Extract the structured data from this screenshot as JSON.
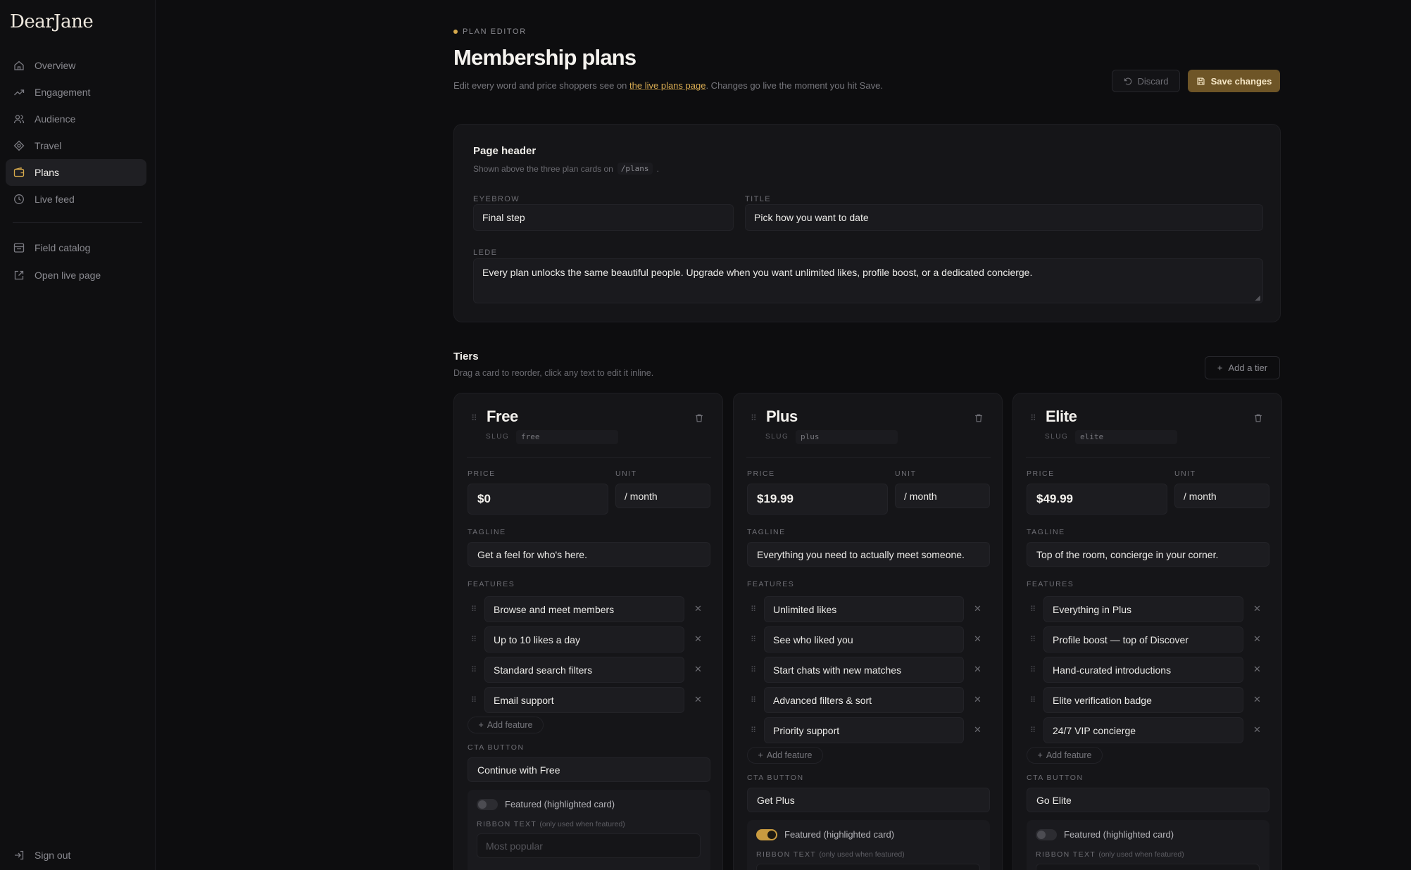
{
  "brand": "DearJane",
  "sidebar": {
    "items": [
      {
        "label": "Overview",
        "icon": "home-icon"
      },
      {
        "label": "Engagement",
        "icon": "trend-up-icon"
      },
      {
        "label": "Audience",
        "icon": "users-icon"
      },
      {
        "label": "Travel",
        "icon": "compass-icon"
      },
      {
        "label": "Plans",
        "icon": "wallet-icon",
        "active": true
      },
      {
        "label": "Live feed",
        "icon": "clock-icon"
      }
    ],
    "secondary": [
      {
        "label": "Field catalog",
        "icon": "catalog-icon"
      },
      {
        "label": "Open live page",
        "icon": "external-link-icon"
      }
    ],
    "signout": "Sign out"
  },
  "header": {
    "eyebrow": "PLAN EDITOR",
    "title": "Membership plans",
    "subtitle_pre": "Edit every word and price shoppers see on ",
    "subtitle_link": "the live plans page",
    "subtitle_post": ". Changes go live the moment you hit Save.",
    "discard_label": "Discard",
    "save_label": "Save changes"
  },
  "page_header_panel": {
    "title": "Page header",
    "subtitle": "Shown above the three plan cards on",
    "path": "/plans",
    "subtitle_end": ".",
    "eyebrow_label": "EYEBROW",
    "eyebrow_value": "Final step",
    "title_label": "TITLE",
    "title_value": "Pick how you want to date",
    "lede_label": "LEDE",
    "lede_value": "Every plan unlocks the same beautiful people. Upgrade when you want unlimited likes, profile boost, or a dedicated concierge."
  },
  "tiers": {
    "title": "Tiers",
    "subtitle": "Drag a card to reorder, click any text to edit it inline.",
    "add_tier_label": "Add a tier",
    "labels": {
      "slug": "SLUG",
      "price": "PRICE",
      "unit": "UNIT",
      "tagline": "TAGLINE",
      "features": "FEATURES",
      "add_feature": "Add feature",
      "cta": "CTA BUTTON",
      "featured": "Featured (highlighted card)",
      "ribbon": "RIBBON TEXT",
      "ribbon_hint": "(only used when featured)",
      "ribbon_placeholder": "Most popular"
    },
    "cards": [
      {
        "name": "Free",
        "slug": "free",
        "price": "$0",
        "unit": "/ month",
        "tagline": "Get a feel for who's here.",
        "features": [
          "Browse and meet members",
          "Up to 10 likes a day",
          "Standard search filters",
          "Email support"
        ],
        "cta": "Continue with Free",
        "featured": false
      },
      {
        "name": "Plus",
        "slug": "plus",
        "price": "$19.99",
        "unit": "/ month",
        "tagline": "Everything you need to actually meet someone.",
        "features": [
          "Unlimited likes",
          "See who liked you",
          "Start chats with new matches",
          "Advanced filters & sort",
          "Priority support"
        ],
        "cta": "Get Plus",
        "featured": true
      },
      {
        "name": "Elite",
        "slug": "elite",
        "price": "$49.99",
        "unit": "/ month",
        "tagline": "Top of the room, concierge in your corner.",
        "features": [
          "Everything in Plus",
          "Profile boost — top of Discover",
          "Hand-curated introductions",
          "Elite verification badge",
          "24/7 VIP concierge"
        ],
        "cta": "Go Elite",
        "featured": false
      }
    ]
  },
  "colors": {
    "accent": "#d6a94c",
    "save_bg": "#6e5527",
    "background": "#0d0d0f",
    "panel": "#151518"
  }
}
